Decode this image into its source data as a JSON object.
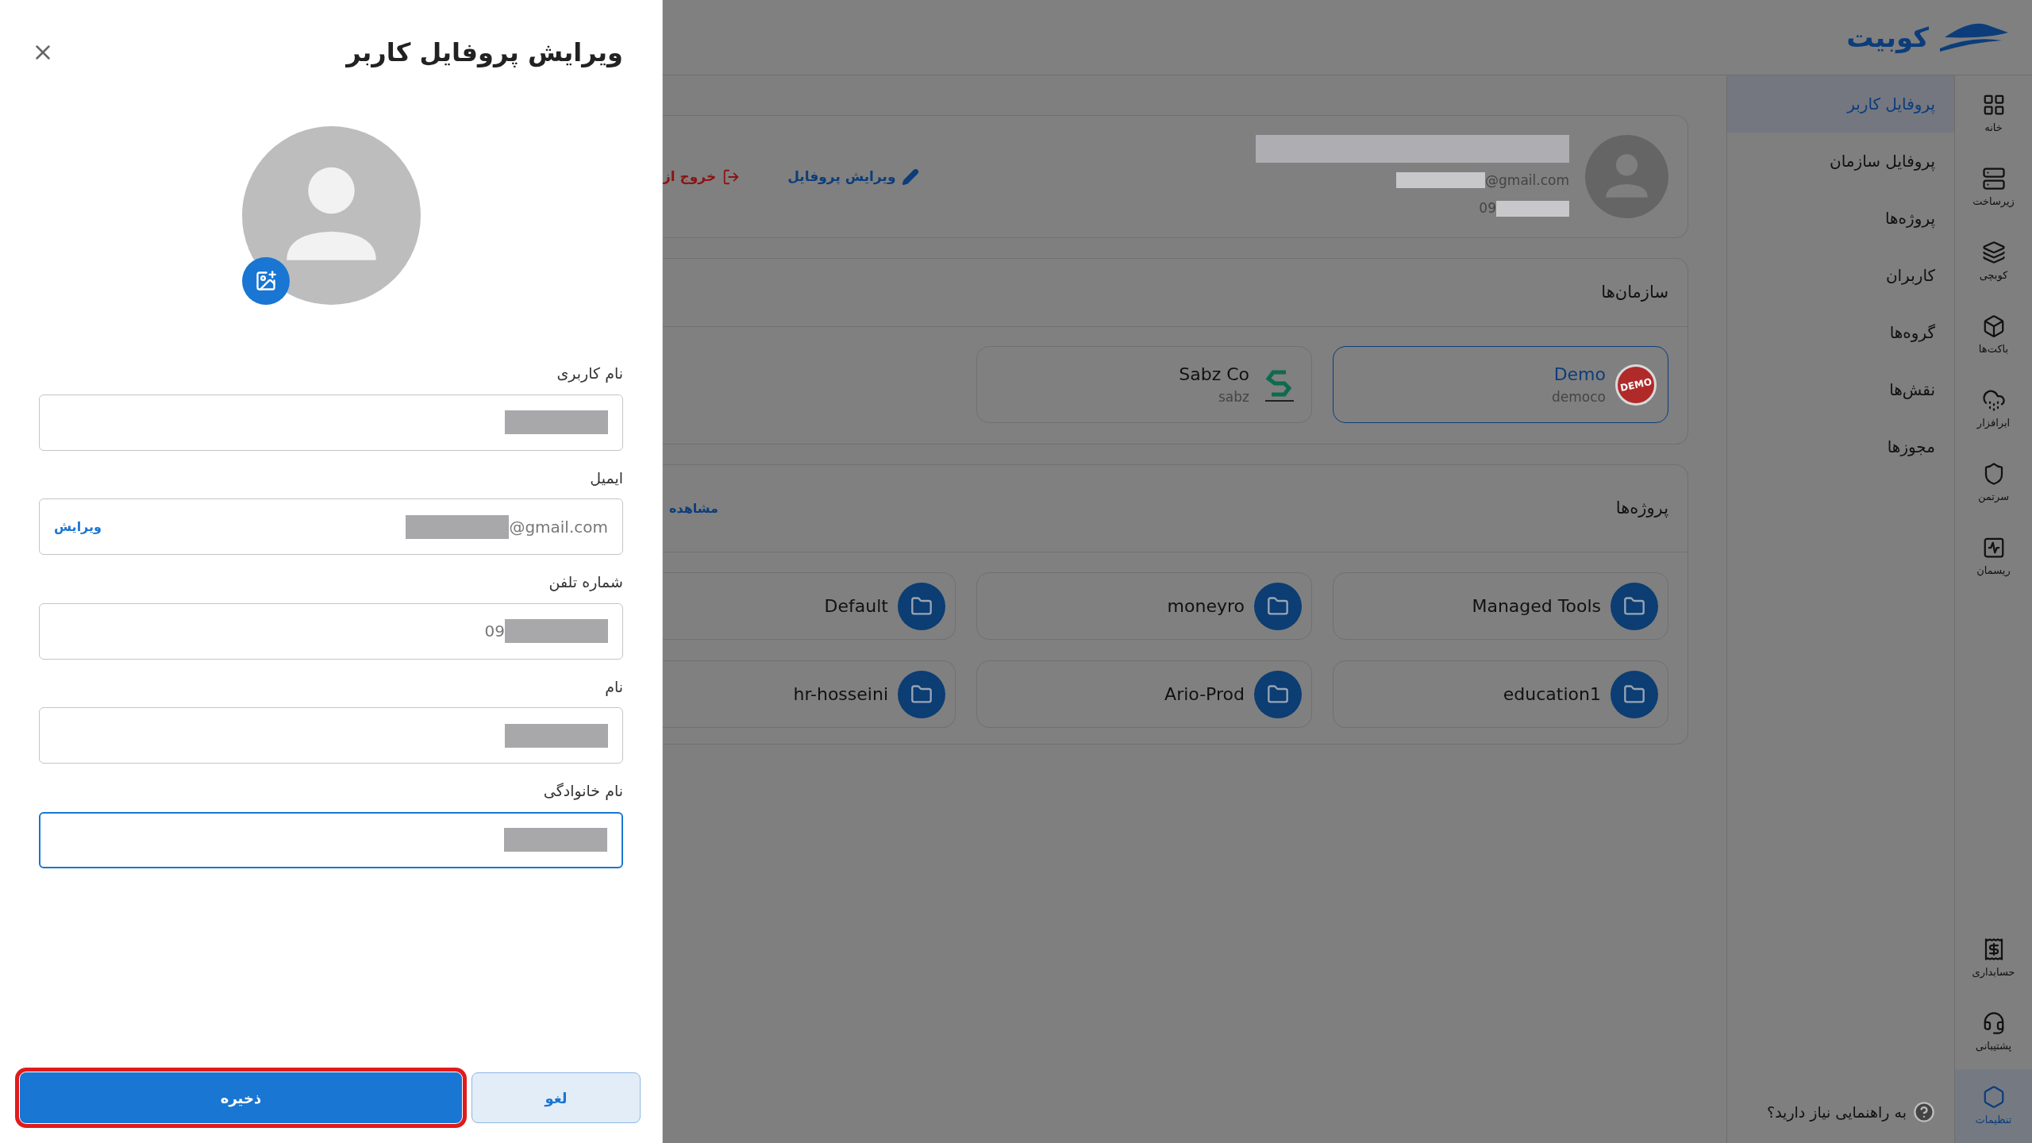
{
  "header": {
    "logo_text": "کوبیت"
  },
  "rail": {
    "top": [
      {
        "label": "خانه",
        "selected": false
      },
      {
        "label": "زیرساخت",
        "selected": false
      },
      {
        "label": "کوبچی",
        "selected": false
      },
      {
        "label": "باکت‌ها",
        "selected": false
      },
      {
        "label": "ابرافزار",
        "selected": false
      },
      {
        "label": "سرتمن",
        "selected": false
      },
      {
        "label": "ریسمان",
        "selected": false
      }
    ],
    "bottom": [
      {
        "label": "حسابداری",
        "selected": false
      },
      {
        "label": "پشتیبانی",
        "selected": false
      },
      {
        "label": "تنظیمات",
        "selected": true
      }
    ]
  },
  "menu": {
    "items": [
      {
        "label": "پروفایل کاربر",
        "selected": true
      },
      {
        "label": "پروفایل سازمان",
        "selected": false
      },
      {
        "label": "پروژه‌ها",
        "selected": false
      },
      {
        "label": "کاربران",
        "selected": false
      },
      {
        "label": "گروه‌ها",
        "selected": false
      },
      {
        "label": "نقش‌ها",
        "selected": false
      },
      {
        "label": "مجوزها",
        "selected": false
      }
    ],
    "help": "به راهنمایی نیاز دارید؟"
  },
  "profile_card": {
    "email_suffix": "@gmail.com",
    "phone_prefix": "09",
    "actions": [
      {
        "label": "ویرایش پروفایل",
        "kind": "edit"
      },
      {
        "label": "خروج از",
        "kind": "logout"
      }
    ]
  },
  "organizations": {
    "title": "سازمان‌ها",
    "items": [
      {
        "name": "Demo",
        "slug": "democo",
        "logo_text": "DEMO",
        "selected": true
      },
      {
        "name": "Sabz Co",
        "slug": "sabz",
        "selected": false
      }
    ]
  },
  "projects": {
    "title": "پروژه‌ها",
    "link": "مشاهده",
    "items": [
      "Managed Tools",
      "moneyro",
      "Default",
      "education1",
      "Ario-Prod",
      "hr-hosseini"
    ]
  },
  "drawer": {
    "title": "ویرایش پروفایل کاربر",
    "fields": [
      {
        "label": "نام کاربری",
        "redacted": true,
        "focused": false
      },
      {
        "label": "ایمیل",
        "suffix": "@gmail.com",
        "action": "ویرایش",
        "redacted": true,
        "focused": false
      },
      {
        "label": "شماره تلفن",
        "prefix": "09",
        "redacted": true,
        "focused": false
      },
      {
        "label": "نام",
        "redacted": true,
        "focused": false
      },
      {
        "label": "نام خانوادگی",
        "redacted": true,
        "focused": true
      }
    ],
    "buttons": [
      {
        "label": "لغو",
        "kind": "secondary",
        "highlighted": false
      },
      {
        "label": "ذخیره",
        "kind": "primary",
        "highlighted": true
      }
    ]
  }
}
